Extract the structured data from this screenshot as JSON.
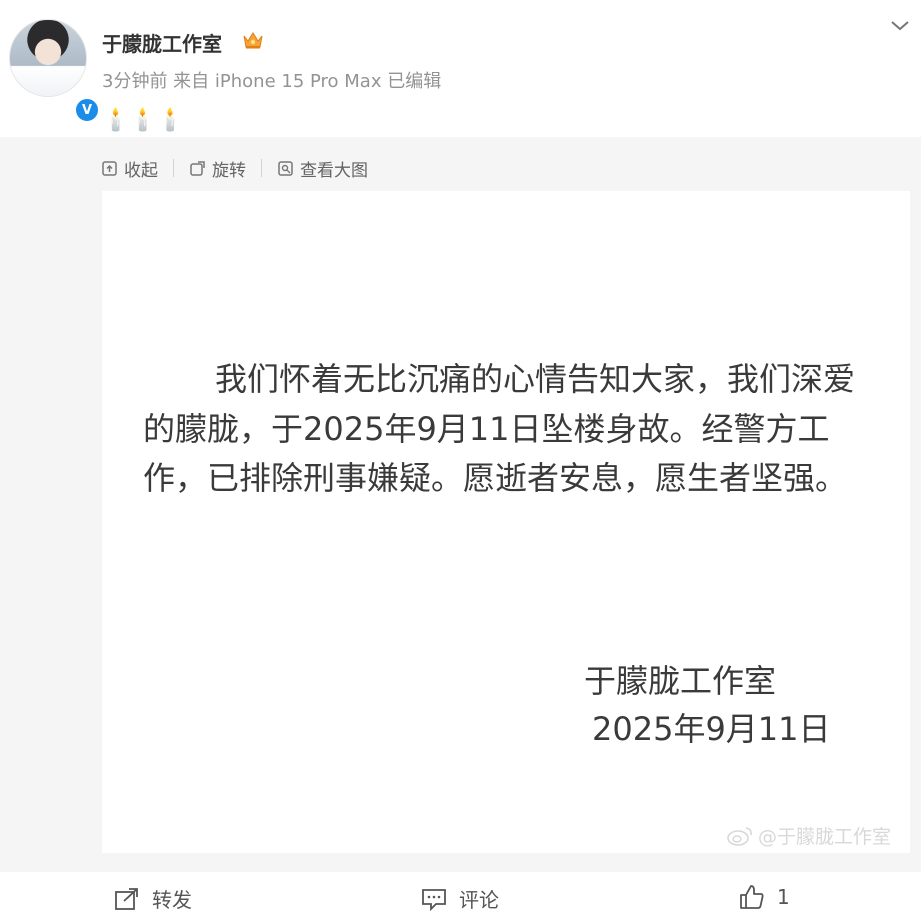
{
  "post": {
    "author": "于朦胧工作室",
    "meta": "3分钟前  来自 iPhone 15 Pro Max 已编辑",
    "text": "🕯️🕯️🕯️",
    "verified": "V"
  },
  "toolbar": {
    "collect": "收起",
    "rotate": "旋转",
    "view_large": "查看大图"
  },
  "image": {
    "statement": "我们怀着无比沉痛的心情告知大家，我们深爱的朦胧，于2025年9月11日坠楼身故。经警方工作，已排除刑事嫌疑。愿逝者安息，愿生者坚强。",
    "signature_name": "于朦胧工作室",
    "signature_date": "2025年9月11日",
    "watermark": "@于朦胧工作室"
  },
  "actions": {
    "repost": "转发",
    "comment": "评论",
    "like_count": "1"
  },
  "colors": {
    "verified_blue": "#1b8ce8",
    "crown_orange": "#f7a33b",
    "gray_bg": "#f5f5f5"
  }
}
